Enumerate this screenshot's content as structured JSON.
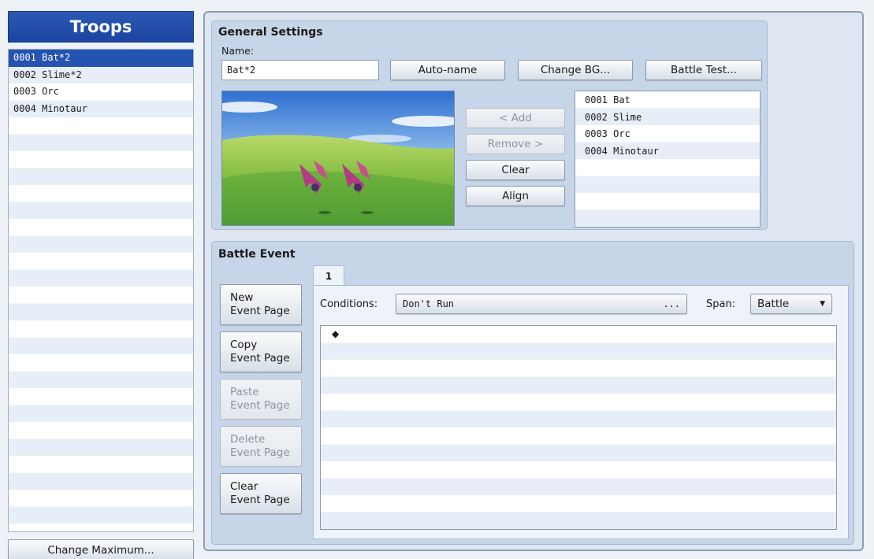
{
  "troops": {
    "title": "Troops",
    "items": [
      {
        "label": "0001 Bat*2"
      },
      {
        "label": "0002 Slime*2"
      },
      {
        "label": "0003 Orc"
      },
      {
        "label": "0004 Minotaur"
      }
    ],
    "selected_index": 0,
    "change_maximum_label": "Change Maximum..."
  },
  "general": {
    "title": "General Settings",
    "name_label": "Name:",
    "name_value": "Bat*2",
    "auto_name_label": "Auto-name",
    "change_bg_label": "Change BG...",
    "battle_test_label": "Battle Test...",
    "add_label": "< Add",
    "remove_label": "Remove >",
    "clear_label": "Clear",
    "align_label": "Align",
    "enemies": [
      {
        "label": "0001 Bat"
      },
      {
        "label": "0002 Slime"
      },
      {
        "label": "0003 Orc"
      },
      {
        "label": "0004 Minotaur"
      }
    ]
  },
  "battle_event": {
    "title": "Battle Event",
    "new_page_line1": "New",
    "new_page_line2": "Event Page",
    "copy_page_line1": "Copy",
    "copy_page_line2": "Event Page",
    "paste_page_line1": "Paste",
    "paste_page_line2": "Event Page",
    "delete_page_line1": "Delete",
    "delete_page_line2": "Event Page",
    "clear_page_line1": "Clear",
    "clear_page_line2": "Event Page",
    "tab_label": "1",
    "conditions_label": "Conditions:",
    "conditions_value": "Don't Run",
    "conditions_ellipsis": "...",
    "span_label": "Span:",
    "span_value": "Battle",
    "command_marker": "◆"
  },
  "colors": {
    "header_blue": "#2453b0",
    "panel_bg": "#c6d5e8"
  }
}
